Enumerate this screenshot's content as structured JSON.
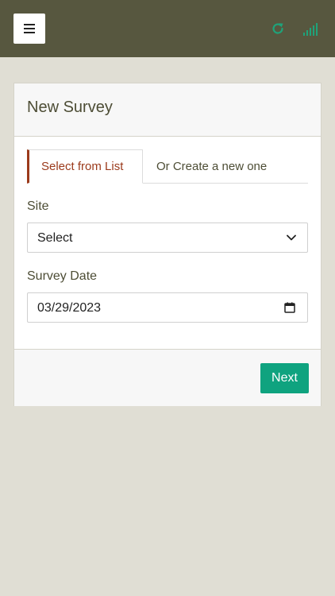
{
  "colors": {
    "topbar": "#57573f",
    "background": "#e0ded4",
    "accent_tab": "#9b3a1b",
    "primary_button": "#0fa37f",
    "status_icons": "#1fa37a"
  },
  "topbar": {
    "menu_icon": "hamburger-icon",
    "refresh_icon": "refresh-icon",
    "signal_icon": "signal-icon"
  },
  "card": {
    "title": "New Survey"
  },
  "tabs": [
    {
      "label": "Select from List",
      "active": true
    },
    {
      "label": "Or Create a new one",
      "active": false
    }
  ],
  "form": {
    "site": {
      "label": "Site",
      "value": "Select"
    },
    "survey_date": {
      "label": "Survey Date",
      "value": "03/29/2023"
    }
  },
  "footer": {
    "next_label": "Next"
  }
}
